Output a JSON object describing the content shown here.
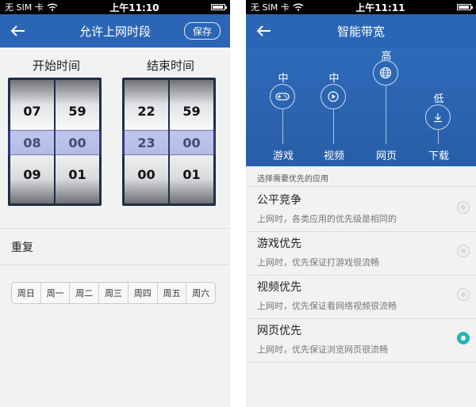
{
  "colors": {
    "nav_blue": "#2b66b6",
    "accent_teal": "#23b7b7"
  },
  "left": {
    "status": {
      "carrier": "无 SIM 卡",
      "time": "上午11:10"
    },
    "nav": {
      "title": "允许上网时段",
      "save_label": "保存",
      "back_icon": "back-arrow-icon"
    },
    "start": {
      "label": "开始时间",
      "hours": [
        "07",
        "08",
        "09"
      ],
      "minutes": [
        "59",
        "00",
        "01"
      ],
      "selected_hour": "08",
      "selected_minute": "00"
    },
    "end": {
      "label": "结束时间",
      "hours": [
        "22",
        "23",
        "00"
      ],
      "minutes": [
        "59",
        "00",
        "01"
      ],
      "selected_hour": "23",
      "selected_minute": "00"
    },
    "repeat_label": "重复",
    "days": [
      "周日",
      "周一",
      "周二",
      "周三",
      "周四",
      "周五",
      "周六"
    ]
  },
  "right": {
    "status": {
      "carrier": "无 SIM 卡",
      "time": "上午11:11"
    },
    "nav": {
      "title": "智能带宽",
      "back_icon": "back-arrow-icon"
    },
    "bandwidth": [
      {
        "name": "游戏",
        "level": "中",
        "icon": "gamepad-icon"
      },
      {
        "name": "视频",
        "level": "中",
        "icon": "play-icon"
      },
      {
        "name": "网页",
        "level": "高",
        "icon": "globe-icon"
      },
      {
        "name": "下载",
        "level": "低",
        "icon": "download-icon"
      }
    ],
    "section_label": "选择需要优先的应用",
    "options": [
      {
        "title": "公平竞争",
        "desc": "上网时，各类应用的优先级是相同的",
        "selected": false
      },
      {
        "title": "游戏优先",
        "desc": "上网时，优先保证打游戏很流畅",
        "selected": false
      },
      {
        "title": "视频优先",
        "desc": "上网时，优先保证看网络视频很流畅",
        "selected": false
      },
      {
        "title": "网页优先",
        "desc": "上网时，优先保证浏览网页很流畅",
        "selected": true
      }
    ]
  }
}
